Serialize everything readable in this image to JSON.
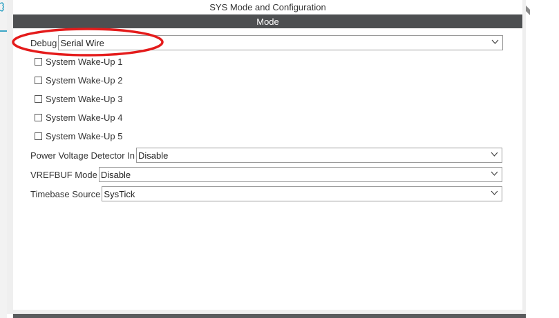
{
  "window": {
    "title": "SYS Mode and Configuration",
    "section": "Mode"
  },
  "fields": {
    "debug": {
      "label": "Debug",
      "value": "Serial Wire"
    },
    "pvd": {
      "label": "Power Voltage Detector In",
      "value": "Disable"
    },
    "vrefbuf": {
      "label": "VREFBUF Mode",
      "value": "Disable"
    },
    "timebase": {
      "label": "Timebase Source",
      "value": "SysTick"
    }
  },
  "wakeups": [
    {
      "label": "System Wake-Up 1",
      "checked": false
    },
    {
      "label": "System Wake-Up 2",
      "checked": false
    },
    {
      "label": "System Wake-Up 3",
      "checked": false
    },
    {
      "label": "System Wake-Up 4",
      "checked": false
    },
    {
      "label": "System Wake-Up 5",
      "checked": false
    }
  ],
  "colors": {
    "mode_bar": "#4d4f51",
    "annotation": "#e41b1b",
    "accent": "#3aa6c6"
  },
  "icons": {
    "gear": "gear-icon",
    "dropdown": "chevron-down-icon"
  }
}
